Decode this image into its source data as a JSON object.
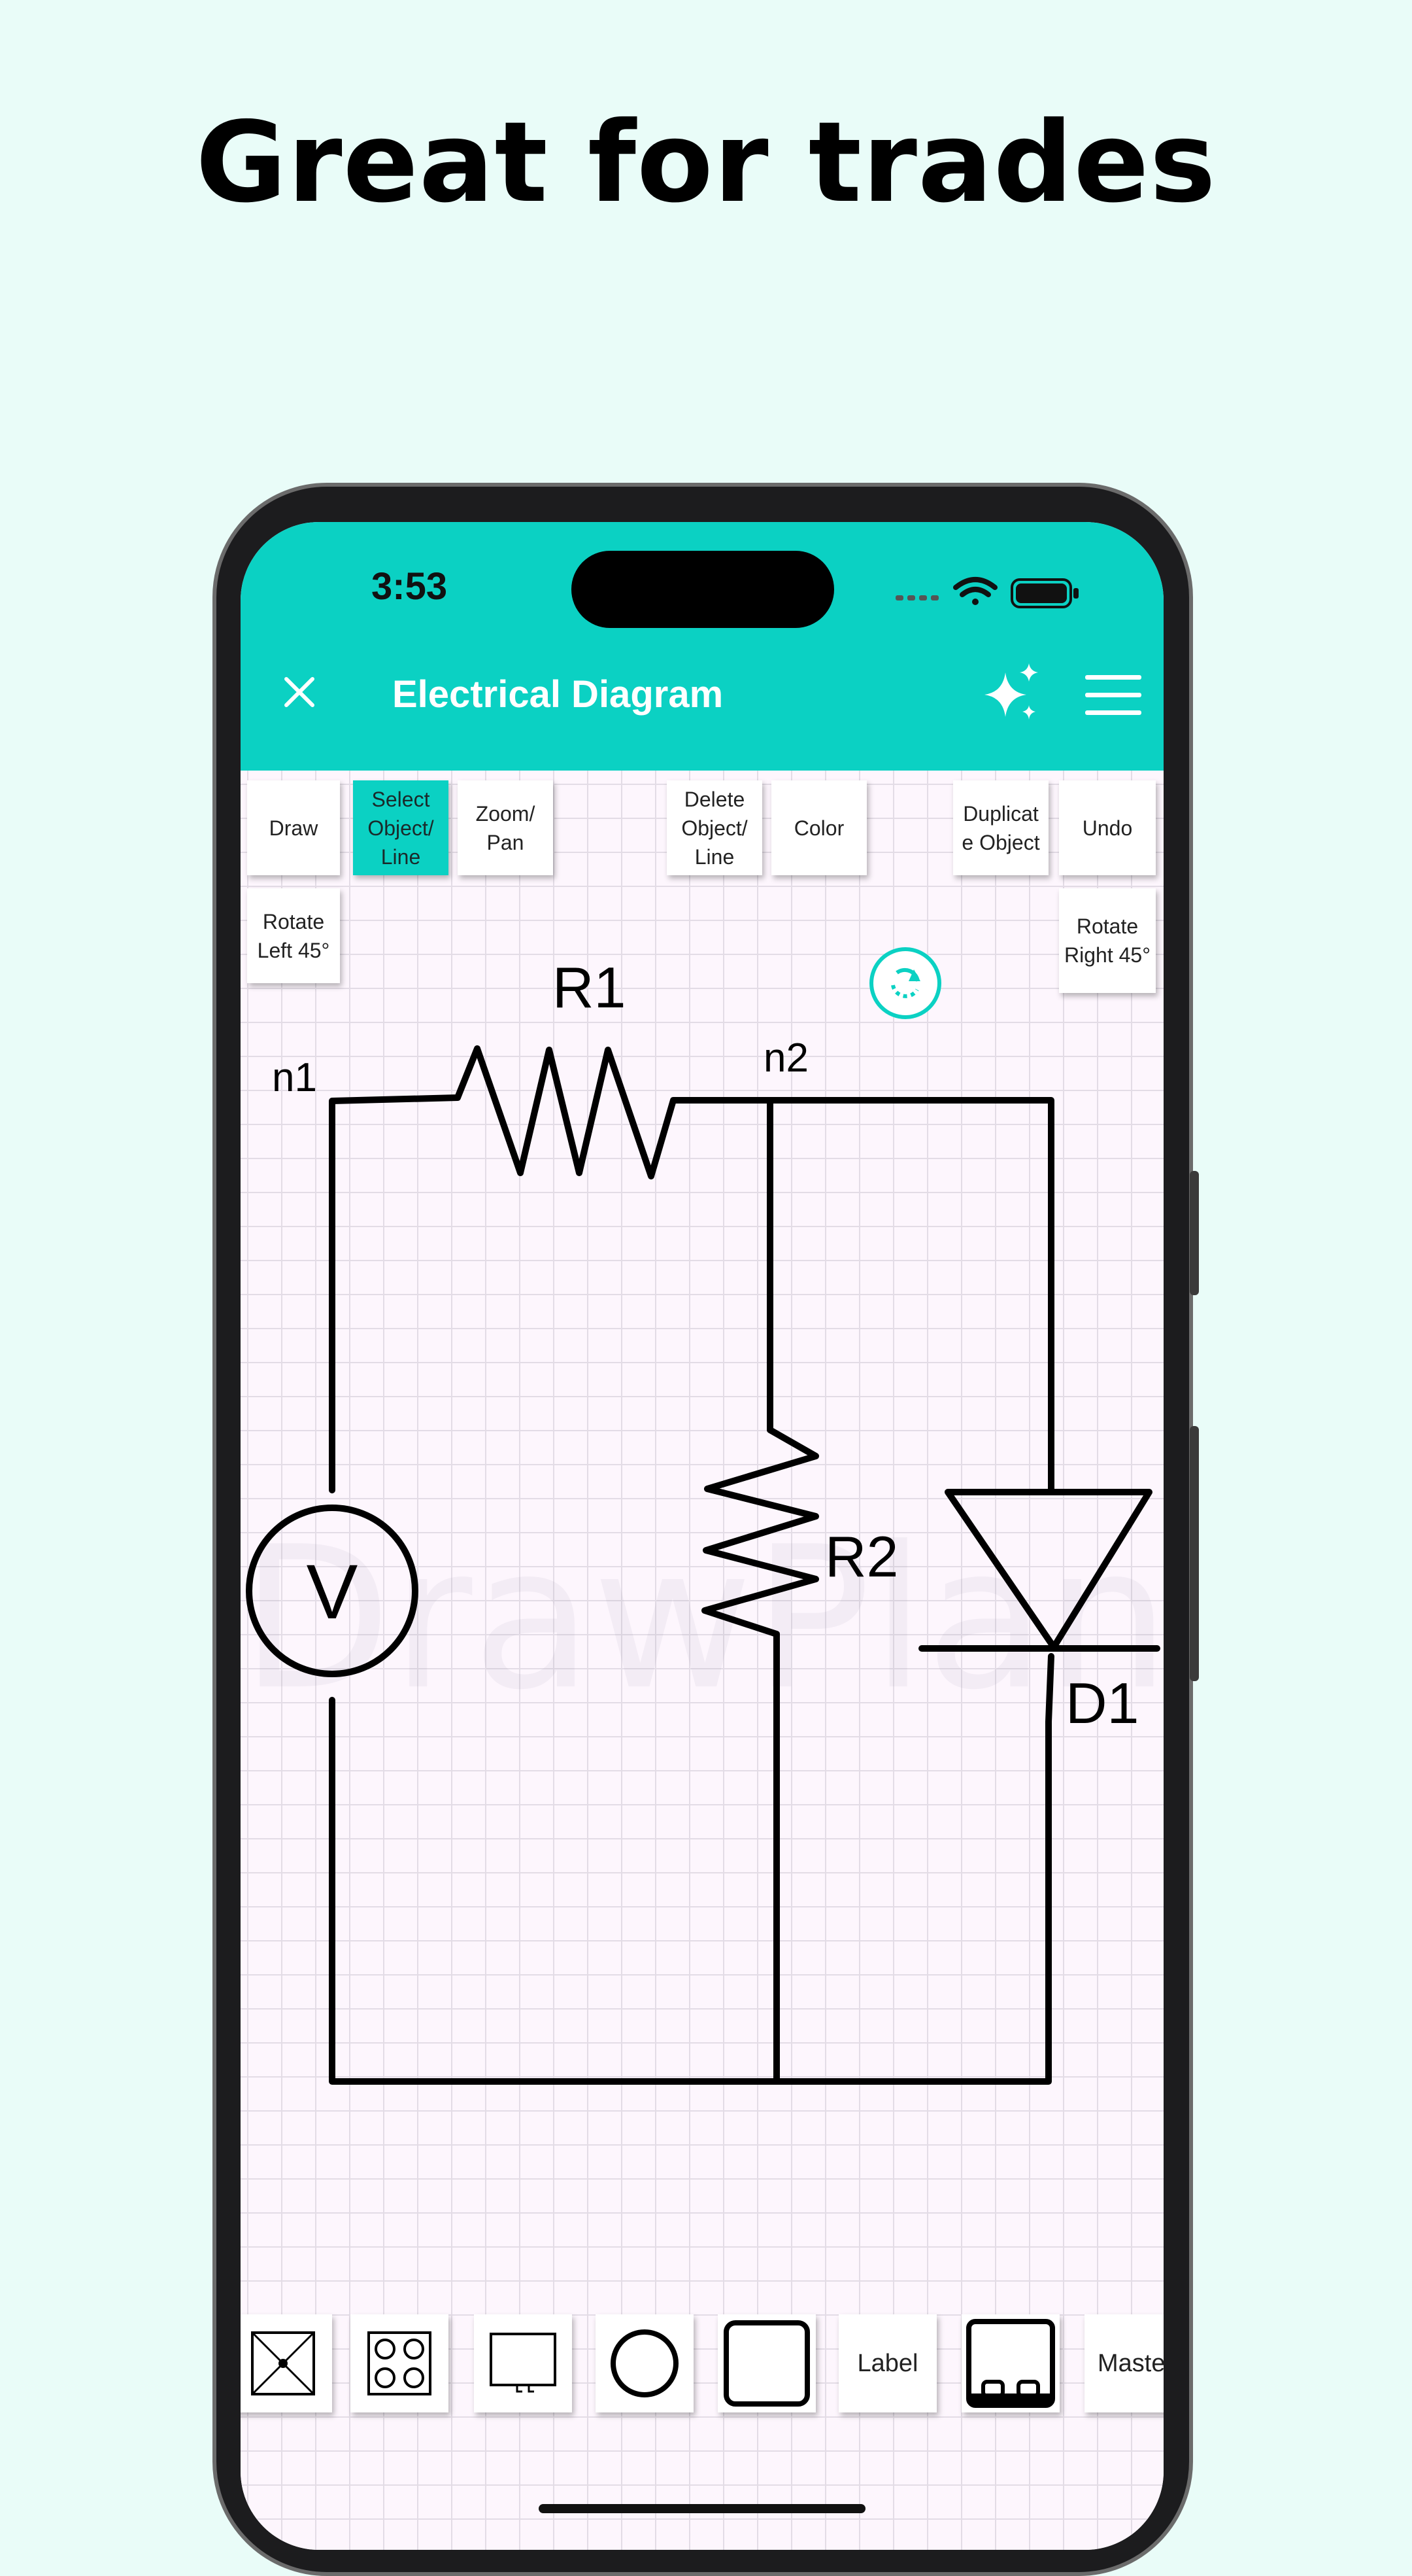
{
  "headline": "Great for trades",
  "status_bar": {
    "time": "3:53"
  },
  "app_bar": {
    "title": "Electrical Diagram"
  },
  "toolbar": {
    "draw": "Draw",
    "select": "Select Object/ Line",
    "zoom_pan": "Zoom/ Pan",
    "delete": "Delete Object/ Line",
    "color": "Color",
    "duplicate": "Duplicat e Object",
    "undo": "Undo",
    "rotate_left": "Rotate Left 45°",
    "rotate_right": "Rotate Right 45°",
    "active_tool": "select"
  },
  "diagram": {
    "node_labels": [
      "n1",
      "n2"
    ],
    "components": [
      {
        "ref": "R1",
        "type": "resistor"
      },
      {
        "ref": "R2",
        "type": "resistor"
      },
      {
        "ref": "D1",
        "type": "diode"
      },
      {
        "ref": "V",
        "type": "voltage-source"
      }
    ],
    "watermark": "DrawPlan"
  },
  "palette": {
    "items": [
      "panel-box",
      "outlet-quad",
      "display-box",
      "circle-shape",
      "rounded-square",
      "Label",
      "appliance-box",
      "Maste"
    ]
  },
  "colors": {
    "accent": "#0bd1c3",
    "background": "#e9fcf8",
    "canvas": "#fdf6fd",
    "grid": "#e3dce6"
  }
}
